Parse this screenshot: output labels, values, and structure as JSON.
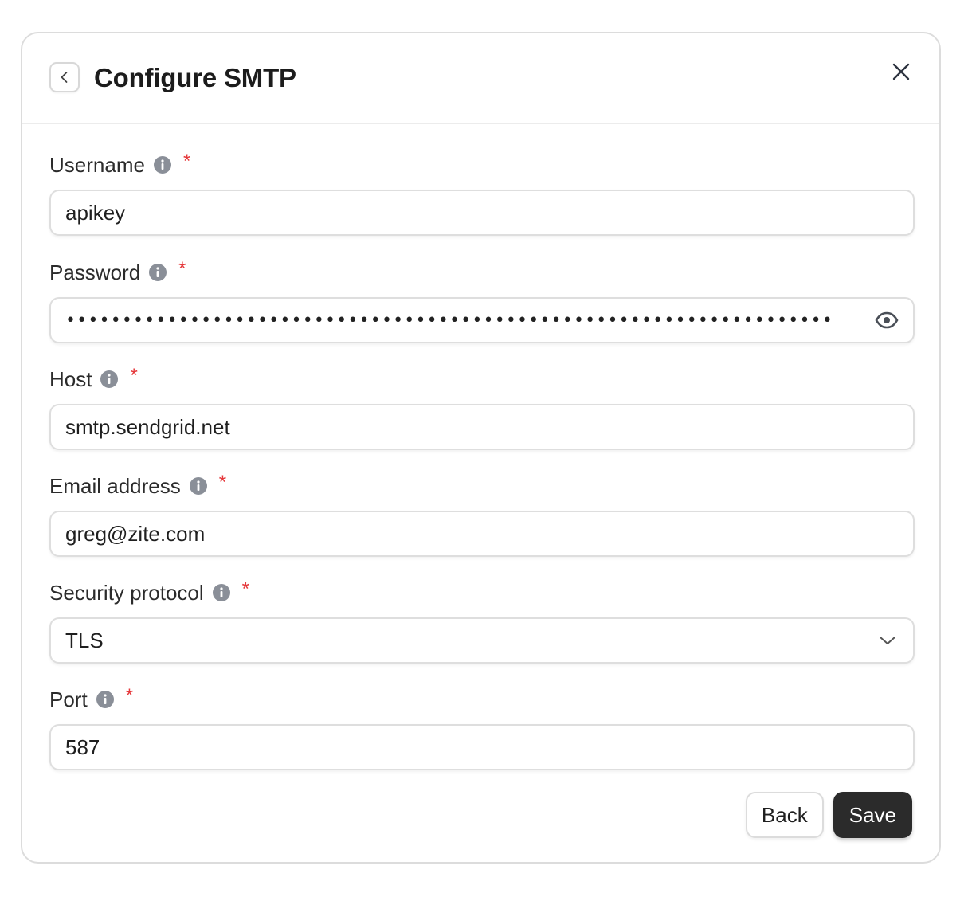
{
  "dialog": {
    "title": "Configure SMTP"
  },
  "fields": {
    "username": {
      "label": "Username",
      "required": "*",
      "value": "apikey"
    },
    "password": {
      "label": "Password",
      "required": "*",
      "value": "••••••••••••••••••••••••••••••••••••••••••••••••••••••••••••••••••••"
    },
    "host": {
      "label": "Host",
      "required": "*",
      "value": "smtp.sendgrid.net"
    },
    "email": {
      "label": "Email address",
      "required": "*",
      "value": "greg@zite.com"
    },
    "security": {
      "label": "Security protocol",
      "required": "*",
      "value": "TLS"
    },
    "port": {
      "label": "Port",
      "required": "*",
      "value": "587"
    }
  },
  "footer": {
    "back_label": "Back",
    "save_label": "Save"
  },
  "icons": {
    "back": "chevron-left-icon",
    "close": "close-icon",
    "info": "info-icon",
    "show_password": "eye-icon",
    "dropdown": "chevron-down-icon"
  },
  "colors": {
    "required": "#e5383b",
    "primary_button": "#2b2b2b",
    "info_icon": "#8a8f98"
  }
}
